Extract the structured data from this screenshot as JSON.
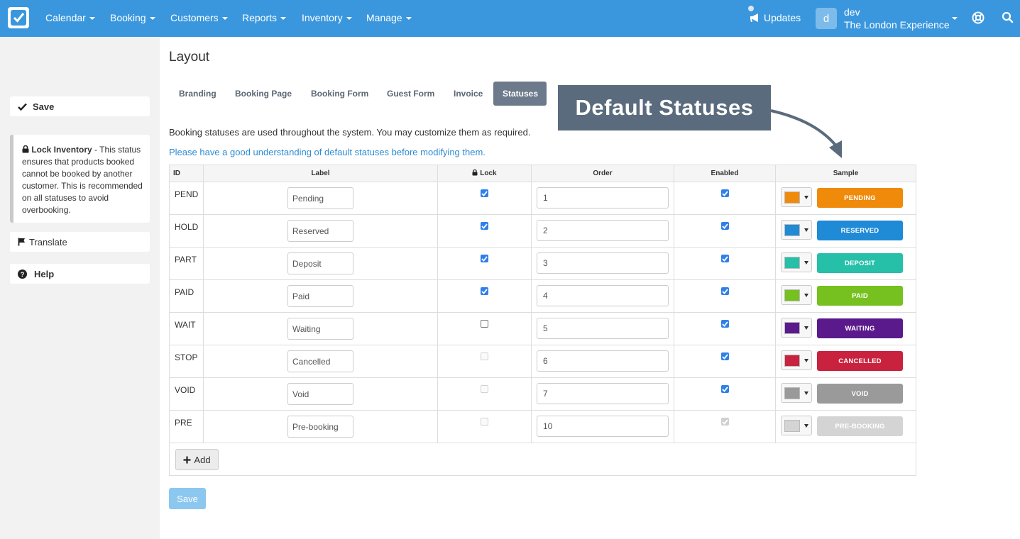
{
  "nav": {
    "items": [
      {
        "label": "Calendar"
      },
      {
        "label": "Booking"
      },
      {
        "label": "Customers"
      },
      {
        "label": "Reports"
      },
      {
        "label": "Inventory"
      },
      {
        "label": "Manage"
      }
    ],
    "updates_label": "Updates",
    "avatar_letter": "d",
    "user_name": "dev",
    "user_org": "The London Experience",
    "accent_color": "#3a97de"
  },
  "sidebar": {
    "save_label": "Save",
    "info_title": "Lock Inventory",
    "info_text": "- This status ensures that products booked cannot be booked by another customer. This is recommended on all statuses to avoid overbooking.",
    "translate_label": "Translate",
    "help_label": "Help"
  },
  "main": {
    "title": "Layout",
    "tabs": [
      {
        "label": "Branding",
        "active": false
      },
      {
        "label": "Booking Page",
        "active": false
      },
      {
        "label": "Booking Form",
        "active": false
      },
      {
        "label": "Guest Form",
        "active": false
      },
      {
        "label": "Invoice",
        "active": false
      },
      {
        "label": "Statuses",
        "active": true
      }
    ],
    "callout": "Default Statuses",
    "description": "Booking statuses are used throughout the system. You may customize them as required.",
    "link_text": "Please have a good understanding of default statuses before modifying them.",
    "table": {
      "headers": {
        "id": "ID",
        "label": "Label",
        "lock": "Lock",
        "order": "Order",
        "enabled": "Enabled",
        "sample": "Sample"
      },
      "rows": [
        {
          "id": "PEND",
          "label": "Pending",
          "lock": "on",
          "order": "1",
          "enabled": "on",
          "color": "#f08a0a",
          "sample": "PENDING"
        },
        {
          "id": "HOLD",
          "label": "Reserved",
          "lock": "on",
          "order": "2",
          "enabled": "on",
          "color": "#1f8ad6",
          "sample": "RESERVED"
        },
        {
          "id": "PART",
          "label": "Deposit",
          "lock": "on",
          "order": "3",
          "enabled": "on",
          "color": "#26bfa8",
          "sample": "DEPOSIT"
        },
        {
          "id": "PAID",
          "label": "Paid",
          "lock": "on",
          "order": "4",
          "enabled": "on",
          "color": "#76c11f",
          "sample": "PAID"
        },
        {
          "id": "WAIT",
          "label": "Waiting",
          "lock": "off",
          "order": "5",
          "enabled": "on",
          "color": "#5a1a8c",
          "sample": "WAITING"
        },
        {
          "id": "STOP",
          "label": "Cancelled",
          "lock": "dis-off",
          "order": "6",
          "enabled": "on",
          "color": "#c8223f",
          "sample": "CANCELLED"
        },
        {
          "id": "VOID",
          "label": "Void",
          "lock": "dis-off",
          "order": "7",
          "enabled": "on",
          "color": "#9a9a9a",
          "sample": "VOID"
        },
        {
          "id": "PRE",
          "label": "Pre-booking",
          "lock": "dis-off",
          "order": "10",
          "enabled": "dis-on",
          "color": "#d4d4d4",
          "sample": "PRE-BOOKING"
        }
      ]
    },
    "add_label": "Add",
    "save_label": "Save"
  }
}
